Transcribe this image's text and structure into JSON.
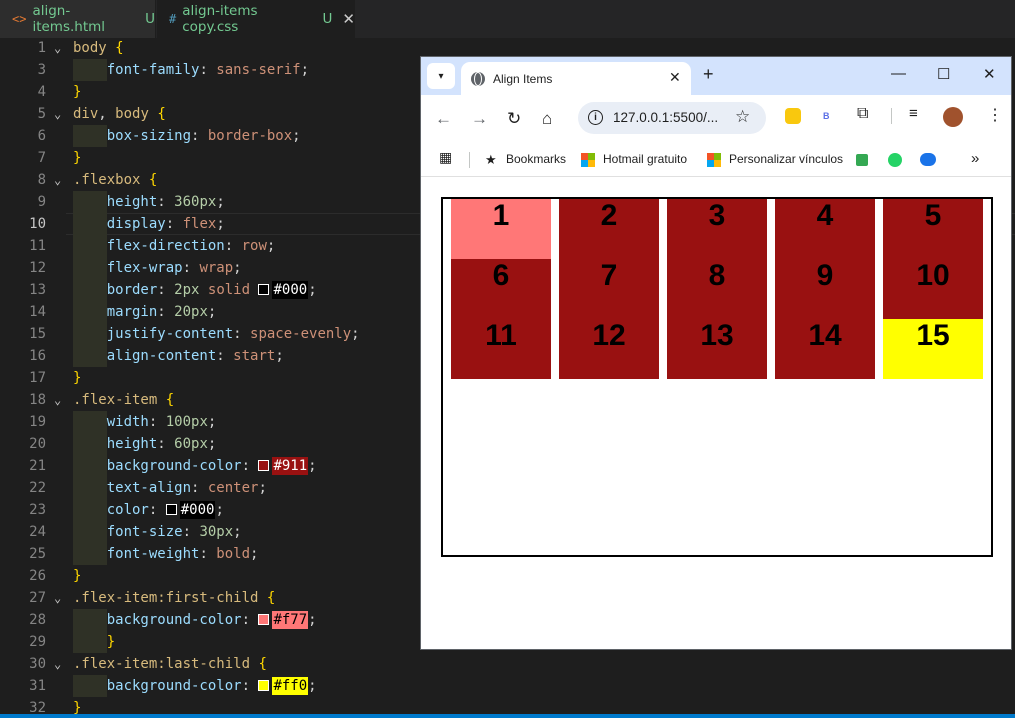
{
  "editor_tabs": [
    {
      "icon": "<>",
      "name": "align-items.html",
      "status": "U"
    },
    {
      "icon": "#",
      "name": "align-items copy.css",
      "status": "U"
    }
  ],
  "code_lines": [
    {
      "n": "1",
      "fold": true,
      "indent": 0,
      "tokens": [
        [
          "sel",
          "body"
        ],
        [
          "punc",
          " "
        ],
        [
          "brace",
          "{"
        ]
      ]
    },
    {
      "n": "3",
      "fold": false,
      "indent": 1,
      "tokens": [
        [
          "prop",
          "font-family"
        ],
        [
          "punc",
          ": "
        ],
        [
          "val",
          "sans-serif"
        ],
        [
          "punc",
          ";"
        ]
      ]
    },
    {
      "n": "4",
      "fold": false,
      "indent": 0,
      "tokens": [
        [
          "brace",
          "}"
        ]
      ]
    },
    {
      "n": "5",
      "fold": true,
      "indent": 0,
      "tokens": [
        [
          "sel",
          "div"
        ],
        [
          "punc",
          ", "
        ],
        [
          "sel",
          "body"
        ],
        [
          "punc",
          " "
        ],
        [
          "brace",
          "{"
        ]
      ]
    },
    {
      "n": "6",
      "fold": false,
      "indent": 1,
      "tokens": [
        [
          "prop",
          "box-sizing"
        ],
        [
          "punc",
          ": "
        ],
        [
          "val",
          "border-box"
        ],
        [
          "punc",
          ";"
        ]
      ]
    },
    {
      "n": "7",
      "fold": false,
      "indent": 0,
      "tokens": [
        [
          "brace",
          "}"
        ]
      ]
    },
    {
      "n": "8",
      "fold": true,
      "indent": 0,
      "tokens": [
        [
          "sel",
          ".flexbox"
        ],
        [
          "punc",
          " "
        ],
        [
          "brace",
          "{"
        ]
      ]
    },
    {
      "n": "9",
      "fold": false,
      "indent": 1,
      "tokens": [
        [
          "prop",
          "height"
        ],
        [
          "punc",
          ": "
        ],
        [
          "num",
          "360px"
        ],
        [
          "punc",
          ";"
        ]
      ]
    },
    {
      "n": "10",
      "fold": false,
      "indent": 1,
      "active": true,
      "tokens": [
        [
          "prop",
          "display"
        ],
        [
          "punc",
          ": "
        ],
        [
          "val",
          "flex"
        ],
        [
          "punc",
          ";"
        ]
      ]
    },
    {
      "n": "11",
      "fold": false,
      "indent": 1,
      "tokens": [
        [
          "prop",
          "flex-direction"
        ],
        [
          "punc",
          ": "
        ],
        [
          "val",
          "row"
        ],
        [
          "punc",
          ";"
        ]
      ]
    },
    {
      "n": "12",
      "fold": false,
      "indent": 1,
      "tokens": [
        [
          "prop",
          "flex-wrap"
        ],
        [
          "punc",
          ": "
        ],
        [
          "val",
          "wrap"
        ],
        [
          "punc",
          ";"
        ]
      ]
    },
    {
      "n": "13",
      "fold": false,
      "indent": 1,
      "tokens": [
        [
          "prop",
          "border"
        ],
        [
          "punc",
          ": "
        ],
        [
          "num",
          "2px"
        ],
        [
          "punc",
          " "
        ],
        [
          "val",
          "solid"
        ],
        [
          "punc",
          " "
        ],
        [
          "swatch",
          "#000",
          "#000000"
        ],
        [
          "punc",
          ";"
        ]
      ]
    },
    {
      "n": "14",
      "fold": false,
      "indent": 1,
      "tokens": [
        [
          "prop",
          "margin"
        ],
        [
          "punc",
          ": "
        ],
        [
          "num",
          "20px"
        ],
        [
          "punc",
          ";"
        ]
      ]
    },
    {
      "n": "15",
      "fold": false,
      "indent": 1,
      "tokens": [
        [
          "prop",
          "justify-content"
        ],
        [
          "punc",
          ": "
        ],
        [
          "val",
          "space-evenly"
        ],
        [
          "punc",
          ";"
        ]
      ]
    },
    {
      "n": "16",
      "fold": false,
      "indent": 1,
      "tokens": [
        [
          "prop",
          "align-content"
        ],
        [
          "punc",
          ": "
        ],
        [
          "val",
          "start"
        ],
        [
          "punc",
          ";"
        ]
      ]
    },
    {
      "n": "17",
      "fold": false,
      "indent": 0,
      "tokens": [
        [
          "brace",
          "}"
        ]
      ]
    },
    {
      "n": "18",
      "fold": true,
      "indent": 0,
      "tokens": [
        [
          "sel",
          ".flex-item"
        ],
        [
          "punc",
          " "
        ],
        [
          "brace",
          "{"
        ]
      ]
    },
    {
      "n": "19",
      "fold": false,
      "indent": 1,
      "tokens": [
        [
          "prop",
          "width"
        ],
        [
          "punc",
          ": "
        ],
        [
          "num",
          "100px"
        ],
        [
          "punc",
          ";"
        ]
      ]
    },
    {
      "n": "20",
      "fold": false,
      "indent": 1,
      "tokens": [
        [
          "prop",
          "height"
        ],
        [
          "punc",
          ": "
        ],
        [
          "num",
          "60px"
        ],
        [
          "punc",
          ";"
        ]
      ]
    },
    {
      "n": "21",
      "fold": false,
      "indent": 1,
      "tokens": [
        [
          "prop",
          "background-color"
        ],
        [
          "punc",
          ": "
        ],
        [
          "swatch",
          "#911",
          "#991111"
        ],
        [
          "punc",
          ";"
        ]
      ]
    },
    {
      "n": "22",
      "fold": false,
      "indent": 1,
      "tokens": [
        [
          "prop",
          "text-align"
        ],
        [
          "punc",
          ": "
        ],
        [
          "val",
          "center"
        ],
        [
          "punc",
          ";"
        ]
      ]
    },
    {
      "n": "23",
      "fold": false,
      "indent": 1,
      "tokens": [
        [
          "prop",
          "color"
        ],
        [
          "punc",
          ": "
        ],
        [
          "swatch",
          "#000",
          "#000000"
        ],
        [
          "punc",
          ";"
        ]
      ]
    },
    {
      "n": "24",
      "fold": false,
      "indent": 1,
      "tokens": [
        [
          "prop",
          "font-size"
        ],
        [
          "punc",
          ": "
        ],
        [
          "num",
          "30px"
        ],
        [
          "punc",
          ";"
        ]
      ]
    },
    {
      "n": "25",
      "fold": false,
      "indent": 1,
      "tokens": [
        [
          "prop",
          "font-weight"
        ],
        [
          "punc",
          ": "
        ],
        [
          "val",
          "bold"
        ],
        [
          "punc",
          ";"
        ]
      ]
    },
    {
      "n": "26",
      "fold": false,
      "indent": 0,
      "tokens": [
        [
          "brace",
          "}"
        ]
      ]
    },
    {
      "n": "27",
      "fold": true,
      "indent": 0,
      "tokens": [
        [
          "sel",
          ".flex-item:first-child"
        ],
        [
          "punc",
          " "
        ],
        [
          "brace",
          "{"
        ]
      ]
    },
    {
      "n": "28",
      "fold": false,
      "indent": 1,
      "tokens": [
        [
          "prop",
          "background-color"
        ],
        [
          "punc",
          ": "
        ],
        [
          "swatch",
          "#f77",
          "#ff7777"
        ],
        [
          "punc",
          ";"
        ]
      ]
    },
    {
      "n": "29",
      "fold": false,
      "indent": 1,
      "tokens": [
        [
          "brace",
          "}"
        ]
      ]
    },
    {
      "n": "30",
      "fold": true,
      "indent": 0,
      "tokens": [
        [
          "sel",
          ".flex-item:last-child"
        ],
        [
          "punc",
          " "
        ],
        [
          "brace",
          "{"
        ]
      ]
    },
    {
      "n": "31",
      "fold": false,
      "indent": 1,
      "tokens": [
        [
          "prop",
          "background-color"
        ],
        [
          "punc",
          ": "
        ],
        [
          "swatch",
          "#ff0",
          "#ffff00"
        ],
        [
          "punc",
          ";"
        ]
      ]
    },
    {
      "n": "32",
      "fold": false,
      "indent": 0,
      "tokens": [
        [
          "brace",
          "}"
        ]
      ]
    }
  ],
  "browser": {
    "tab_title": "Align Items",
    "new_tab_label": "+",
    "url": "127.0.0.1:5500/...",
    "bookmarks": [
      "Bookmarks",
      "Hotmail gratuito",
      "Personalizar vínculos"
    ],
    "more_bookmarks": "»",
    "flex_items": [
      "1",
      "2",
      "3",
      "4",
      "5",
      "6",
      "7",
      "8",
      "9",
      "10",
      "11",
      "12",
      "13",
      "14",
      "15"
    ]
  },
  "colors": {
    "item_bg": "#991111",
    "first_child_bg": "#ff7777",
    "last_child_bg": "#ffff00",
    "editor_bg": "#1e1e1e",
    "browser_titlebar": "#d3e3fd"
  }
}
